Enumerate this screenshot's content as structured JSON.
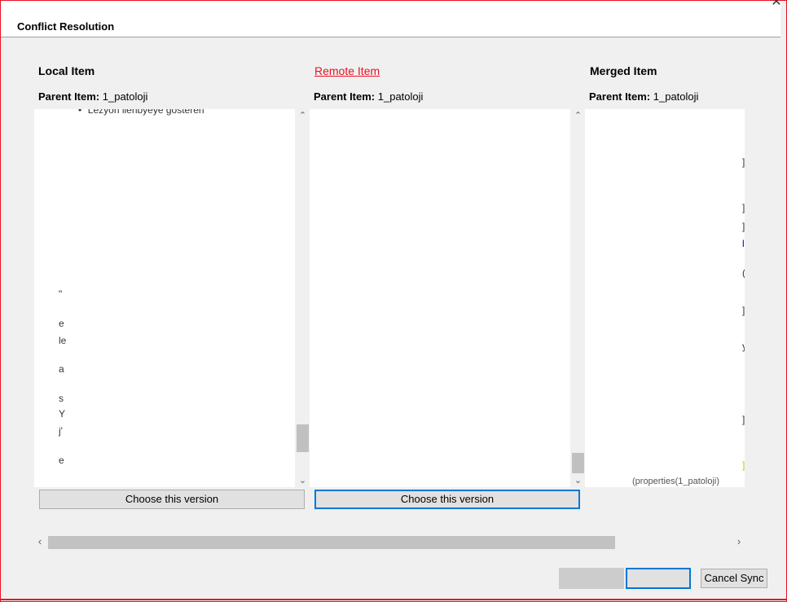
{
  "dialog": {
    "title": "Conflict Resolution",
    "close_icon": "close-icon"
  },
  "columns": {
    "local": {
      "header": "Local Item",
      "parent_label": "Parent Item:",
      "parent_value": "1_patoloji",
      "choose_label": "Choose this version"
    },
    "remote": {
      "header": "Remote Item",
      "parent_label": "Parent Item:",
      "parent_value": "1_patoloji",
      "choose_label": "Choose this version"
    },
    "merged": {
      "header": "Merged Item",
      "parent_label": "Parent Item:",
      "parent_value": "1_patoloji"
    }
  },
  "local_fragments": [
    "• \"Lezyon lienbyeye gösteren",
    "\"",
    "e",
    "le",
    "a",
    "s",
    "Y",
    "j'",
    "e"
  ],
  "merged_fragments": [
    "]",
    "]",
    "]",
    "l",
    "(",
    "]",
    "y",
    "]",
    "]",
    "(properties(1_patoloji)"
  ],
  "footer": {
    "cancel_sync_label": "Cancel Sync"
  },
  "colors": {
    "accent": "#0078d7",
    "alert": "#e81123"
  }
}
